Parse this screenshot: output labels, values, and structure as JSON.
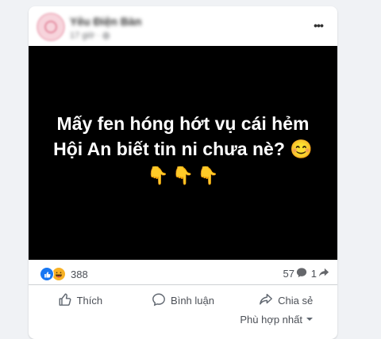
{
  "post": {
    "page_name": "Yêu Điện Bàn",
    "time": "17 giờ · ",
    "text_line1": "Mấy fen hóng hớt vụ cái hẻm",
    "text_line2": "Hội An biết tin ni chưa nè? 😊",
    "emojis": [
      "👇",
      "👇",
      "👇"
    ]
  },
  "stats": {
    "reaction_count": "388",
    "comment_count": "57",
    "share_count": "1"
  },
  "actions": {
    "like_label": "Thích",
    "comment_label": "Bình luận",
    "share_label": "Chia sẻ"
  },
  "comments_sort": {
    "label": "Phù hợp nhất"
  },
  "colors": {
    "background": "#f0f2f5",
    "like_blue": "#1877f2",
    "haha_yellow": "#f7b125",
    "text_gray": "#4b4f56"
  }
}
